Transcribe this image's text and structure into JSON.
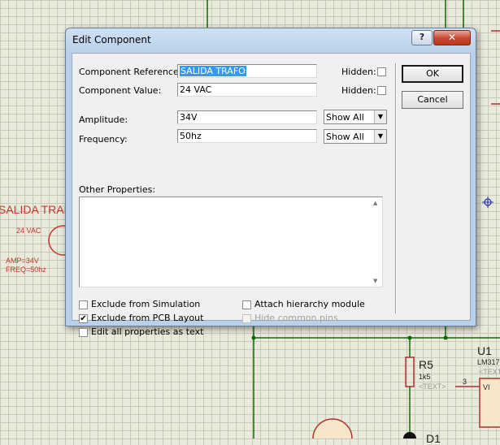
{
  "schematic": {
    "component_name": "SALIDA TRAFO",
    "component_value": "24 VAC",
    "amp_label": "AMP=34V",
    "freq_label": "FREQ=50hz",
    "r5_name": "R5",
    "r5_value": "1k5",
    "r5_text": "<TEXT>",
    "u1_name": "U1",
    "u1_part": "LM317",
    "u1_text": "<TEXT",
    "pin_number": "3",
    "pin_name": "VI",
    "d1_name": "D1"
  },
  "dialog": {
    "title": "Edit Component",
    "help_label": "?",
    "close_label": "✕",
    "component_reference_label": "Component Reference:",
    "component_reference_value": "SALIDA TRAFO",
    "component_value_label": "Component Value:",
    "component_value_value": "24 VAC",
    "hidden_label": "Hidden:",
    "amplitude_label": "Amplitude:",
    "amplitude_value": "34V",
    "amplitude_show": "Show All",
    "frequency_label": "Frequency:",
    "frequency_value": "50hz",
    "frequency_show": "Show All",
    "other_properties_label": "Other Properties:",
    "other_properties_value": "",
    "ok_label": "OK",
    "cancel_label": "Cancel",
    "checkboxes": {
      "exclude_simulation": {
        "label": "Exclude from Simulation",
        "checked": false
      },
      "exclude_pcb": {
        "label": "Exclude from PCB Layout",
        "checked": true
      },
      "edit_all_text": {
        "label": "Edit all properties as text",
        "checked": false
      },
      "attach_hierarchy": {
        "label": "Attach hierarchy module",
        "checked": false
      },
      "hide_common_pins": {
        "label": "Hide common pins",
        "checked": false,
        "disabled": true
      }
    }
  }
}
